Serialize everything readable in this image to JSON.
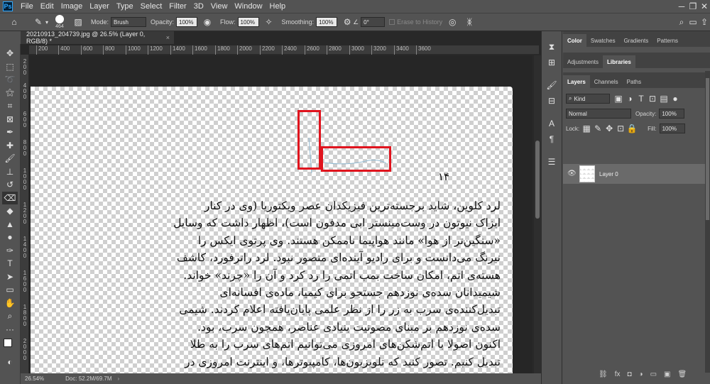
{
  "menubar": {
    "logo": "Ps",
    "items": [
      "File",
      "Edit",
      "Image",
      "Layer",
      "Type",
      "Select",
      "Filter",
      "3D",
      "View",
      "Window",
      "Help"
    ]
  },
  "options": {
    "brush_size": "464",
    "mode_label": "Mode:",
    "mode_value": "Brush",
    "opacity_label": "Opacity:",
    "opacity_value": "100%",
    "flow_label": "Flow:",
    "flow_value": "100%",
    "smoothing_label": "Smoothing:",
    "smoothing_value": "100%",
    "angle_value": "0°",
    "erase_history_label": "Erase to History"
  },
  "document": {
    "tab_title": "20210913_204739.jpg @ 26.5% (Layer 0, RGB/8) *",
    "close_glyph": "×",
    "ruler_h": [
      "200",
      "400",
      "600",
      "800",
      "1000",
      "1200",
      "1400",
      "1600",
      "1800",
      "2000",
      "2200",
      "2400",
      "2600",
      "2800",
      "3000",
      "3200",
      "3400",
      "3600"
    ],
    "ruler_v": [
      "2",
      "0",
      "0",
      "4",
      "0",
      "0",
      "6",
      "0",
      "0",
      "8",
      "0",
      "0",
      "1",
      "0",
      "0",
      "0",
      "1",
      "2",
      "0",
      "0",
      "1",
      "4",
      "0",
      "0",
      "1",
      "6",
      "0",
      "0",
      "1",
      "8",
      "0",
      "0",
      "2",
      "0",
      "0",
      "0"
    ],
    "page_number": "۱۴",
    "text_lines": [
      "لرد کلوین، شاید برجسته‌ترین فیزیکدان عصر ویکتوریا (وی در کنار",
      "ایزاک نیوتون در وست‌مینستر ابی مدفون است)، اظهار داشت که وسایل",
      "«سنگین‌تر از هوا» مانند هواپیما ناممکن هستند. وی پرتوی ایکس را",
      "نیرنگ می‌دانست و برای رادیو آینده‌ای متصور نبود. لرد راترفورد، کاشف",
      "هسته‌ی اتم، امکان ساخت بمب اتمی را رد کرد و آن را «چرند» خواند.",
      "شیمیدانان سده‌ی نوزدهم جستجو برای کیمیا، ماده‌ی افسانه‌ای",
      "تبدیل‌کننده‌ی سرب به زر را از نظر علمی پایان‌یافته اعلام کردند. شیمی",
      "سده‌ی نوزدهم بر مبنای مصونیت بنیادی عناصر، همچون سرب، بود.",
      "اکنون اصولا با اتم‌شکن‌های امروزی می‌توانیم اتم‌های سرب را به طلا",
      "تبدیل کنیم. تصور کنید که تلویزیون‌ها، کامپیوترها، و اینترنت امروزی در"
    ]
  },
  "status": {
    "zoom": "26.54%",
    "doc_info": "Doc: 52.2M/69.7M",
    "arrow": "›"
  },
  "panels": {
    "top_tabs": [
      "Color",
      "Swatches",
      "Gradients",
      "Patterns"
    ],
    "mid_tabs": [
      "Adjustments",
      "Libraries"
    ],
    "layer_tabs": [
      "Layers",
      "Channels",
      "Paths"
    ],
    "filter_kind": "Kind",
    "blend_mode": "Normal",
    "opacity_label": "Opacity:",
    "opacity_value": "100%",
    "lock_label": "Lock:",
    "fill_label": "Fill:",
    "fill_value": "100%",
    "layer_name": "Layer 0",
    "bottom_icons": [
      "⛓",
      "fx",
      "◘",
      "◑",
      "▭",
      "▣",
      "🗑"
    ]
  },
  "colors": {
    "highlight_box": "#e0141e",
    "app_bg": "#535353"
  }
}
